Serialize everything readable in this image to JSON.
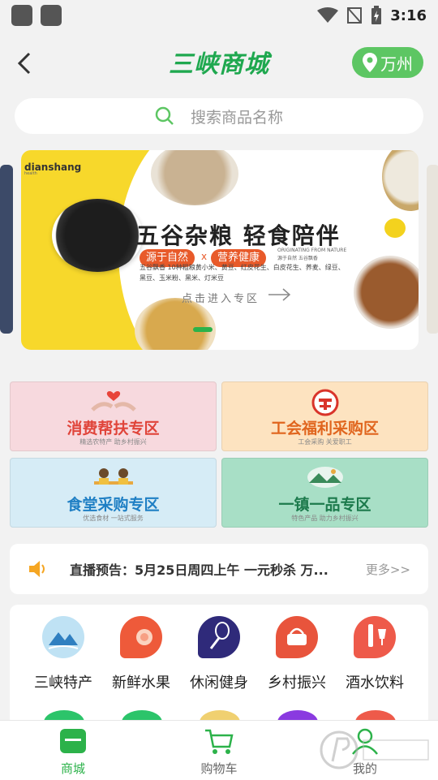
{
  "status_bar": {
    "time": "3:16"
  },
  "header": {
    "logo_text": "三峡商城",
    "location": "万州"
  },
  "search": {
    "placeholder": "搜索商品名称"
  },
  "banner": {
    "brand": "dianshang",
    "brand_sub": "health",
    "title": "五谷杂粮 轻食陪伴",
    "tags": [
      "源于自然",
      "营养健康"
    ],
    "tag_separator": "x",
    "english_line": "ORIGINATING FROM NATURE",
    "english_line2": "源于自然 五谷飘香",
    "details": "五谷飘香 10种粗粮黄小米、黄豆、红皮花生、白皮花生、荞麦、绿豆、黑豆、玉米粉、黑米、灯米豆",
    "enter_text": "点击进入专区",
    "slide_count": 3,
    "active_slide": 1
  },
  "zones": [
    {
      "title": "消费帮扶专区",
      "subtitle": "精选农特产  助乡村振兴",
      "bg": "#f7d9de",
      "color": "#e0443a"
    },
    {
      "title": "工会福利采购区",
      "subtitle": "工会采购  关爱职工",
      "bg": "#fde3c0",
      "color": "#e0651e"
    },
    {
      "title": "食堂采购专区",
      "subtitle": "优选食材  一站式服务",
      "bg": "#d6ecf6",
      "color": "#1f7fc4"
    },
    {
      "title": "一镇一品专区",
      "subtitle": "特色产品  助力乡村振兴",
      "bg": "#a8dfc6",
      "color": "#1c7a4c"
    }
  ],
  "notice": {
    "text": "直播预告：5月25日周四上午 一元秒杀 万...",
    "more": "更多>>"
  },
  "categories": [
    {
      "label": "三峡特产",
      "icon": "mountain-icon",
      "color": "#7ec5ea"
    },
    {
      "label": "新鲜水果",
      "icon": "fruit-icon",
      "color": "#ee5a3a"
    },
    {
      "label": "休闲健身",
      "icon": "badminton-icon",
      "color": "#3a2a8a"
    },
    {
      "label": "乡村振兴",
      "icon": "basket-icon",
      "color": "#e8543c"
    },
    {
      "label": "酒水饮料",
      "icon": "wine-icon",
      "color": "#ee5a4a"
    }
  ],
  "tabbar": [
    {
      "label": "商城",
      "icon": "shop-icon"
    },
    {
      "label": "购物车",
      "icon": "cart-icon"
    },
    {
      "label": "我的",
      "icon": "user-icon"
    }
  ],
  "accent_color": "#2cb24a"
}
